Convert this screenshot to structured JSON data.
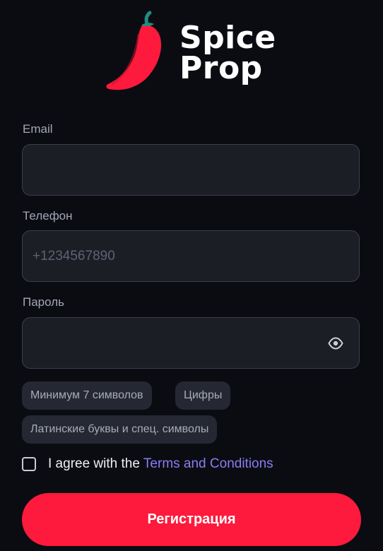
{
  "brand": {
    "name_line1": "Spice",
    "name_line2": "Prop",
    "logo_icon": "chili-pepper-icon",
    "colors": {
      "pepper_red": "#fe1a3c",
      "stem_green": "#1e8f7f"
    }
  },
  "form": {
    "email": {
      "label": "Email",
      "value": "",
      "placeholder": ""
    },
    "phone": {
      "label": "Телефон",
      "value": "",
      "placeholder": "+1234567890"
    },
    "password": {
      "label": "Пароль",
      "value": "",
      "placeholder": "",
      "toggle_icon": "eye-icon"
    },
    "requirements": [
      "Минимум 7 символов",
      "Цифры",
      "Латинские буквы и спец. символы"
    ],
    "agree": {
      "checked": false,
      "text": "I agree with the",
      "link_text": "Terms and Conditions"
    },
    "submit_label": "Регистрация"
  },
  "colors": {
    "background": "#0a0c12",
    "input_bg": "#1c1e26",
    "input_border": "#3c3f4b",
    "chip_bg": "#252832",
    "link": "#8a7df2",
    "primary_button": "#fe1a3c"
  }
}
